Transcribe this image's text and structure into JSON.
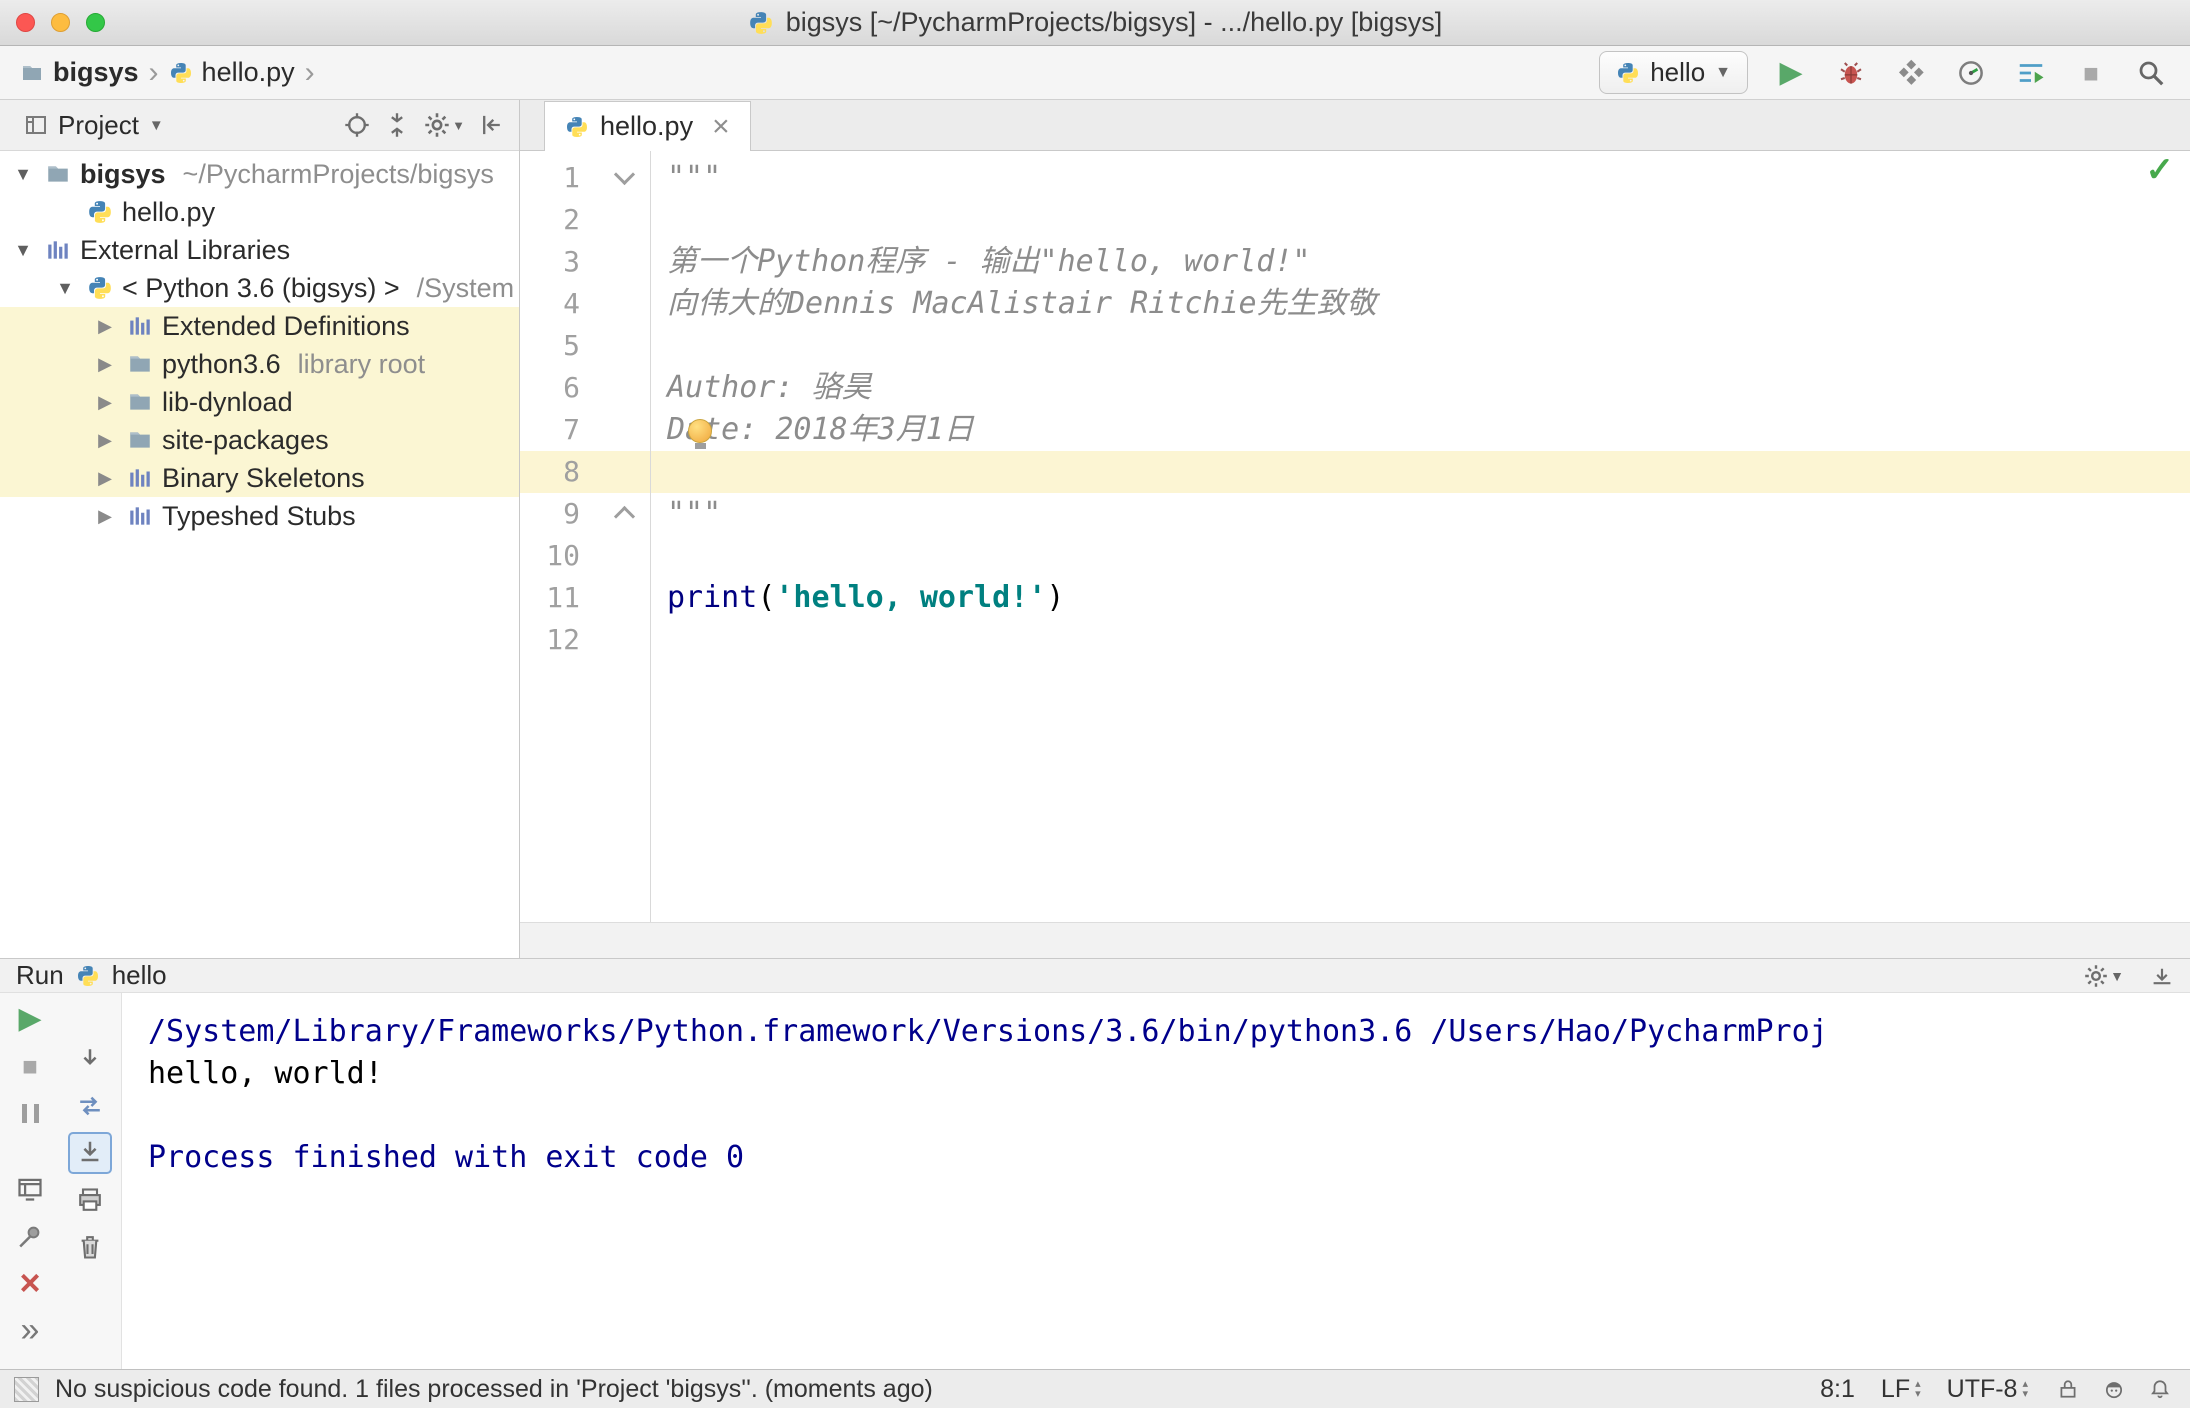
{
  "colors": {
    "keyword": "#000080",
    "string": "#008080",
    "docstring": "#8c8c8c",
    "console_info": "#00008b",
    "run_green": "#59a869",
    "tree_highlight": "#fbf6d3",
    "caret_line": "#fcf5d3"
  },
  "titlebar": {
    "title": "bigsys [~/PycharmProjects/bigsys] - .../hello.py [bigsys]",
    "controls": [
      "close",
      "minimize",
      "zoom"
    ]
  },
  "navbar": {
    "breadcrumbs": [
      {
        "label": "bigsys",
        "icon": "folder"
      },
      {
        "label": "hello.py",
        "icon": "python"
      }
    ],
    "run_config_label": "hello",
    "toolbar": [
      {
        "name": "run-button",
        "icon": "play"
      },
      {
        "name": "debug-button",
        "icon": "bug"
      },
      {
        "name": "coverage-button",
        "icon": "coverage"
      },
      {
        "name": "profiler-button",
        "icon": "profiler"
      },
      {
        "name": "console-button",
        "icon": "console"
      },
      {
        "name": "stop-button",
        "icon": "square"
      },
      {
        "name": "search-everywhere-button",
        "icon": "search"
      }
    ]
  },
  "project_panel": {
    "header": {
      "title": "Project",
      "icons": [
        {
          "name": "locate-button",
          "icon": "locate"
        },
        {
          "name": "collapse-all-button",
          "icon": "collapse"
        },
        {
          "name": "settings-button",
          "icon": "gear",
          "caret": true
        },
        {
          "name": "hide-panel-button",
          "icon": "hidepanel"
        }
      ]
    },
    "tree": [
      {
        "label": "bigsys",
        "suffix": "~/PycharmProjects/bigsys",
        "icon": "folder",
        "indent": 0,
        "expander": "expanded",
        "bold": true
      },
      {
        "label": "hello.py",
        "icon": "python",
        "indent": 1,
        "expander": "none"
      },
      {
        "label": "External Libraries",
        "icon": "library",
        "indent": 0,
        "expander": "expanded"
      },
      {
        "label": "< Python 3.6 (bigsys) >",
        "suffix": "/System",
        "icon": "python",
        "indent": 1,
        "expander": "expanded"
      },
      {
        "label": "Extended Definitions",
        "icon": "library",
        "indent": 2,
        "expander": "collapsed",
        "highlight": true
      },
      {
        "label": "python3.6",
        "suffix": "library root",
        "icon": "folder",
        "indent": 2,
        "expander": "collapsed",
        "highlight": true
      },
      {
        "label": "lib-dynload",
        "icon": "folder",
        "indent": 2,
        "expander": "collapsed",
        "highlight": true
      },
      {
        "label": "site-packages",
        "icon": "folder",
        "indent": 2,
        "expander": "collapsed",
        "highlight": true
      },
      {
        "label": "Binary Skeletons",
        "icon": "library",
        "indent": 2,
        "expander": "collapsed",
        "highlight": true
      },
      {
        "label": "Typeshed Stubs",
        "icon": "library",
        "indent": 2,
        "expander": "collapsed"
      }
    ]
  },
  "editor": {
    "tab_label": "hello.py",
    "inspection_ok": true,
    "lines": [
      {
        "n": 1,
        "fold": "down",
        "segments": [
          {
            "s": "doc",
            "t": "\"\"\""
          }
        ]
      },
      {
        "n": 2,
        "segments": []
      },
      {
        "n": 3,
        "segments": [
          {
            "s": "doc",
            "t": "第一个Python程序 - 输出\"hello, world!\""
          }
        ]
      },
      {
        "n": 4,
        "segments": [
          {
            "s": "doc",
            "t": "向伟大的Dennis MacAlistair Ritchie先生致敬"
          }
        ]
      },
      {
        "n": 5,
        "segments": []
      },
      {
        "n": 6,
        "segments": [
          {
            "s": "doc",
            "t": "Author: 骆昊"
          }
        ]
      },
      {
        "n": 7,
        "segments": [
          {
            "s": "doc",
            "t": "Date: 2018年3月1日"
          }
        ]
      },
      {
        "n": 8,
        "caret": true,
        "segments": []
      },
      {
        "n": 9,
        "fold": "up",
        "segments": [
          {
            "s": "doc",
            "t": "\"\"\""
          }
        ]
      },
      {
        "n": 10,
        "segments": []
      },
      {
        "n": 11,
        "segments": [
          {
            "s": "kw",
            "t": "print"
          },
          {
            "s": "plain",
            "t": "("
          },
          {
            "s": "str",
            "t": "'hello, world!'"
          },
          {
            "s": "plain",
            "t": ")"
          }
        ]
      },
      {
        "n": 12,
        "segments": []
      }
    ]
  },
  "run_panel": {
    "title": "Run",
    "config_label": "hello",
    "toolbar": {
      "col1": [
        {
          "name": "rerun-button",
          "icon": "play"
        },
        {
          "name": "stop-button",
          "icon": "square"
        },
        {
          "name": "pause-output-button",
          "icon": "pause"
        },
        {
          "name": "restore-layout-button",
          "icon": "monitor",
          "gap": true
        },
        {
          "name": "pin-tab-button",
          "icon": "pin"
        },
        {
          "name": "close-button",
          "icon": "closex"
        },
        {
          "name": "more-options-button",
          "icon": "more"
        }
      ],
      "col2": [
        {
          "name": "down-stack-trace-button",
          "icon": "arrdown"
        },
        {
          "name": "soft-wrap-button",
          "icon": "wrap"
        },
        {
          "name": "scroll-to-end-button",
          "icon": "scrollend",
          "selected": true
        },
        {
          "name": "print-button",
          "icon": "printer"
        },
        {
          "name": "clear-all-button",
          "icon": "trash"
        }
      ]
    },
    "console": [
      {
        "kind": "cmd",
        "text": "/System/Library/Frameworks/Python.framework/Versions/3.6/bin/python3.6 /Users/Hao/PycharmProj"
      },
      {
        "kind": "out",
        "text": "hello, world!"
      },
      {
        "kind": "out",
        "text": ""
      },
      {
        "kind": "info",
        "text": "Process finished with exit code 0"
      }
    ]
  },
  "statusbar": {
    "message": "No suspicious code found. 1 files processed in 'Project 'bigsys''. (moments ago)",
    "caret_pos": "8:1",
    "line_sep": "LF",
    "encoding": "UTF-8",
    "icons": [
      {
        "name": "readonly-lock-icon",
        "icon": "lock"
      },
      {
        "name": "highlighting-level-icon",
        "icon": "hector"
      },
      {
        "name": "event-log-icon",
        "icon": "bell"
      }
    ]
  }
}
